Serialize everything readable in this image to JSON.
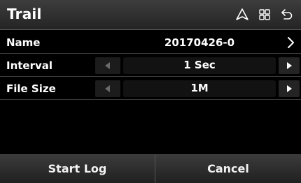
{
  "header": {
    "title": "Trail",
    "icons": [
      "navigation-arrow-icon",
      "grid-menu-icon",
      "back-icon"
    ]
  },
  "rows": {
    "name": {
      "label": "Name",
      "value": "20170426-0"
    },
    "interval": {
      "label": "Interval",
      "value": "1 Sec"
    },
    "file_size": {
      "label": "File Size",
      "value": "1M"
    }
  },
  "footer": {
    "start_log": "Start Log",
    "cancel": "Cancel"
  },
  "colors": {
    "background": "#000000",
    "text": "#ffffff",
    "disabled_arrow": "#6a6a6a"
  }
}
